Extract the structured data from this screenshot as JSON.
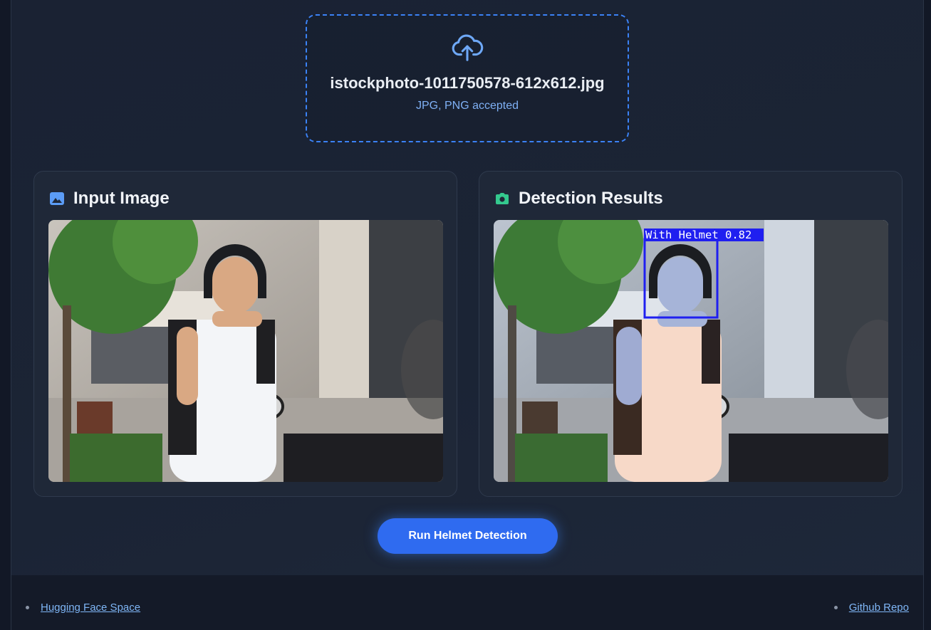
{
  "upload": {
    "icon": "cloud-upload-icon",
    "file_name": "istockphoto-1011750578-612x612.jpg",
    "accepted_text": "JPG, PNG accepted"
  },
  "input_card": {
    "icon": "image-icon",
    "title": "Input Image"
  },
  "result_card": {
    "icon": "camera-icon",
    "title": "Detection Results",
    "detection_label": "With Helmet 0.82"
  },
  "run_button": {
    "label": "Run Helmet Detection"
  },
  "footer": {
    "links": [
      {
        "label": "Hugging Face Space"
      },
      {
        "label": "Github Repo"
      }
    ]
  },
  "colors": {
    "accent": "#2f6bf0",
    "dropzone_border": "#3b82f6",
    "link": "#7fb6f6",
    "box": "#1f1ff0"
  }
}
